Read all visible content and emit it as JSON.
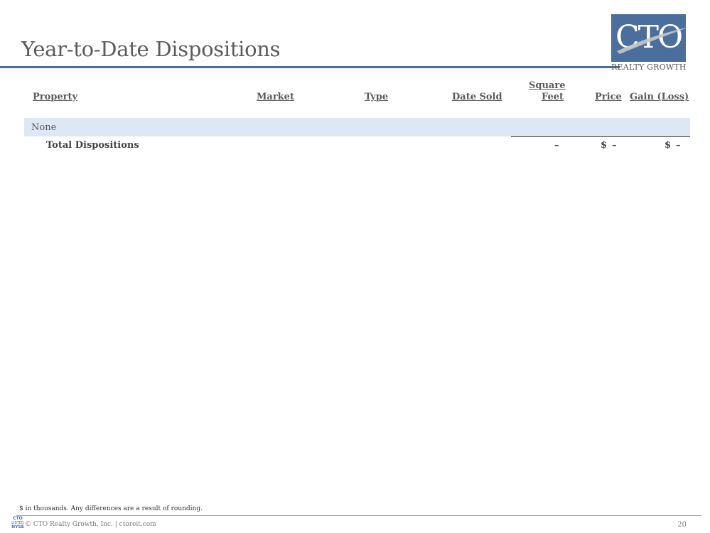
{
  "header": {
    "title": "Year-to-Date Dispositions"
  },
  "logo": {
    "mark": "CTO",
    "tagline": "REALTY GROWTH",
    "brand_color": "#4a6f9d"
  },
  "table": {
    "columns": {
      "property": "Property",
      "market": "Market",
      "type": "Type",
      "date_sold": "Date Sold",
      "square_feet_line1": "Square",
      "square_feet_line2": "Feet",
      "price": "Price",
      "gain_loss": "Gain (Loss)"
    },
    "rows": [
      {
        "property": "None"
      }
    ],
    "total": {
      "label": "Total Dispositions",
      "square_feet": "–",
      "price_currency": "$",
      "price": "–",
      "gain_currency": "$",
      "gain": "–"
    },
    "row_highlight_color": "#dde8f4"
  },
  "footer": {
    "note": "$ in thousands. Any differences are a result of rounding.",
    "mini_logo_line1": "CTO",
    "mini_logo_line2": "LISTED",
    "mini_logo_line3": "NYSE",
    "copyright": "© CTO Realty Growth, Inc. | ctoreit.com",
    "page_number": "20"
  }
}
